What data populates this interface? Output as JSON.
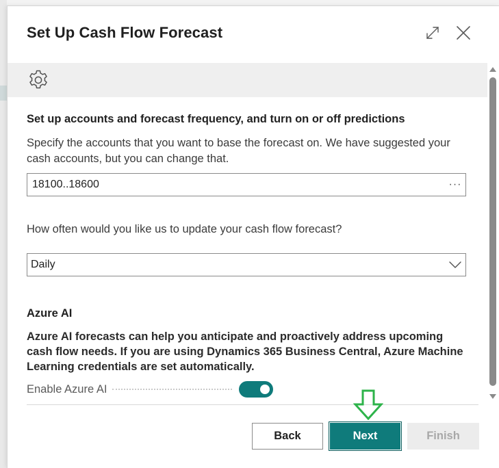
{
  "dialog": {
    "title": "Set Up Cash Flow Forecast",
    "icons": {
      "expand": "expand-icon",
      "close": "close-icon",
      "banner": "gear-icon"
    }
  },
  "step": {
    "heading": "Set up accounts and forecast frequency, and turn on or off predictions",
    "description": "Specify the accounts that you want to base the forecast on. We have suggested your cash accounts, but you can change that.",
    "accounts_value": "18100..18600",
    "accounts_lookup": "···",
    "frequency_question": "How often would you like us to update your cash flow forecast?",
    "frequency_value": "Daily"
  },
  "azure_ai": {
    "title": "Azure AI",
    "description": "Azure AI forecasts can help you anticipate and proactively address upcoming cash flow needs. If you are using Dynamics 365 Business Central, Azure Machine Learning credentials are set automatically.",
    "toggle_label": "Enable Azure AI",
    "enabled": true
  },
  "footer": {
    "back_label": "Back",
    "next_label": "Next",
    "finish_label": "Finish",
    "finish_disabled": true
  },
  "colors": {
    "accent": "#0f7b7b",
    "annotation_arrow": "#2db34a"
  }
}
